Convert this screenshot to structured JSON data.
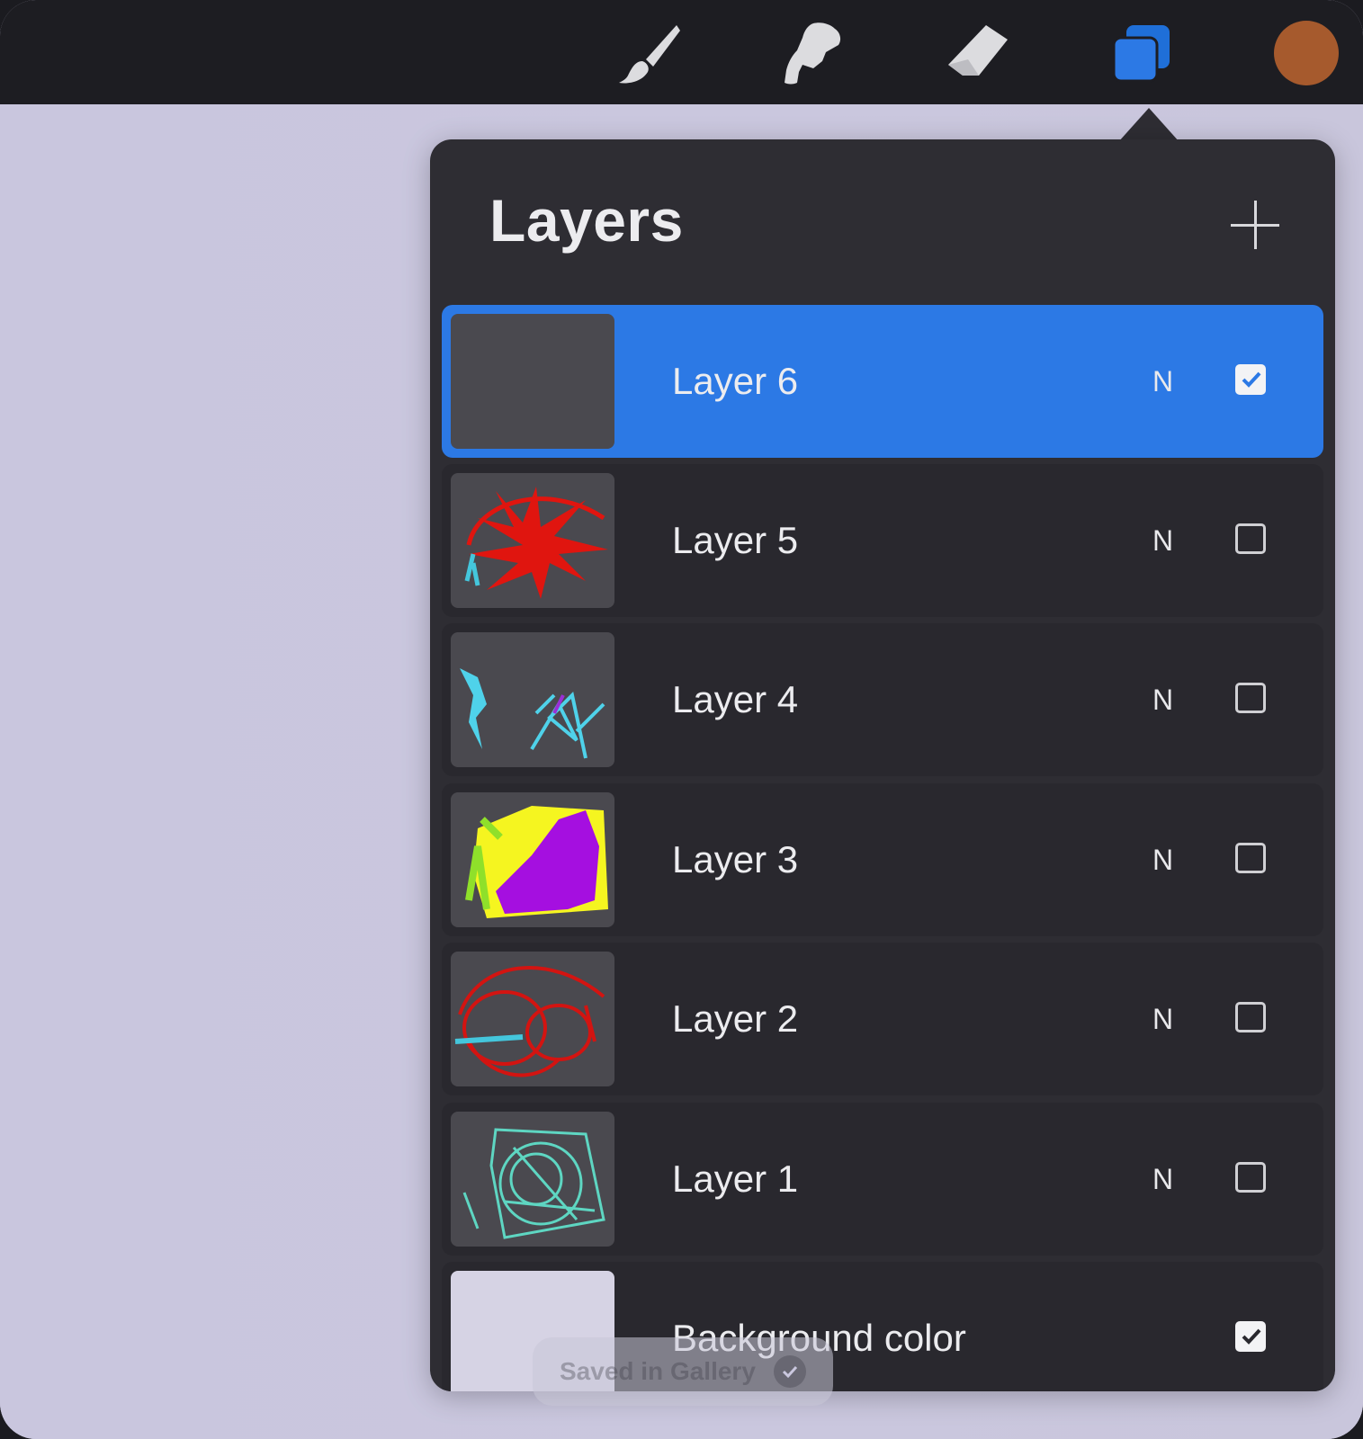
{
  "toolbar": {
    "tools": [
      {
        "name": "brush-icon"
      },
      {
        "name": "smudge-icon"
      },
      {
        "name": "eraser-icon"
      },
      {
        "name": "layers-icon",
        "active": true
      }
    ],
    "current_color": "#a65a2d",
    "accent": "#2c79e5"
  },
  "layers_panel": {
    "title": "Layers",
    "add_icon": "plus-icon",
    "layers": [
      {
        "name": "Layer 6",
        "blend_mode": "N",
        "visible": true,
        "selected": true,
        "thumbnail": "empty"
      },
      {
        "name": "Layer 5",
        "blend_mode": "N",
        "visible": false,
        "selected": false,
        "thumbnail": "red-scribble"
      },
      {
        "name": "Layer 4",
        "blend_mode": "N",
        "visible": false,
        "selected": false,
        "thumbnail": "cyan-strokes"
      },
      {
        "name": "Layer 3",
        "blend_mode": "N",
        "visible": false,
        "selected": false,
        "thumbnail": "yellow-purple-fill"
      },
      {
        "name": "Layer 2",
        "blend_mode": "N",
        "visible": false,
        "selected": false,
        "thumbnail": "red-loops"
      },
      {
        "name": "Layer 1",
        "blend_mode": "N",
        "visible": false,
        "selected": false,
        "thumbnail": "teal-scribble"
      }
    ],
    "background": {
      "name": "Background color",
      "visible": true,
      "color": "#d6d3e4"
    }
  },
  "toast": {
    "text": "Saved in Gallery"
  }
}
